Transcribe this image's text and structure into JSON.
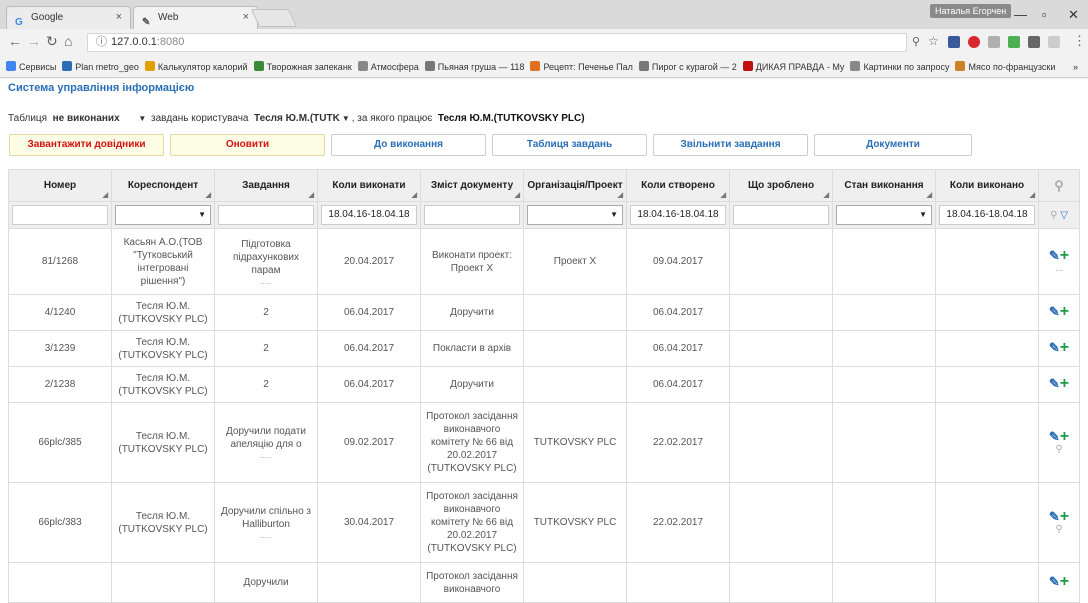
{
  "browser": {
    "tabs": [
      {
        "label": "Google",
        "icon": "G"
      },
      {
        "label": "Web",
        "icon": "✎"
      }
    ],
    "user_chip": "Наталья Егорчен",
    "url_host": "127.0.0.1",
    "url_port": ":8080",
    "bookmarks": [
      {
        "label": "Сервисы",
        "color": "#4285f4"
      },
      {
        "label": "Plan metro_geo",
        "color": "#2a6fb5"
      },
      {
        "label": "Калькулятор калорий",
        "color": "#e0a000"
      },
      {
        "label": "Творожная запеканк",
        "color": "#3a8a3a"
      },
      {
        "label": "Атмосфера",
        "color": "#888888"
      },
      {
        "label": "Пьяная груша — 118",
        "color": "#777777"
      },
      {
        "label": "Рецепт: Печенье Пал",
        "color": "#e07020"
      },
      {
        "label": "Пирог с курагой — 2",
        "color": "#777777"
      },
      {
        "label": "ДИКАЯ ПРАВДА - Му",
        "color": "#c01010"
      },
      {
        "label": "Картинки по запросу",
        "color": "#888888"
      },
      {
        "label": "Мясо по-французски",
        "color": "#d08020"
      }
    ]
  },
  "app": {
    "title": "Система управління інформацією",
    "filter": {
      "prefix": "Таблиця",
      "status": "не виконаних",
      "mid": "завдань користувача",
      "user": "Тесля Ю.М.(TUTK",
      "suffix": ", за якого працює",
      "works_for": "Тесля Ю.М.(TUTKOVSKY PLC)"
    },
    "buttons": [
      "Завантажити довідники",
      "Оновити",
      "До виконання",
      "Таблиця завдань",
      "Звільнити завдання",
      "Документи"
    ]
  },
  "table": {
    "columns": [
      "Номер",
      "Кореспондент",
      "Завдання",
      "Коли виконати",
      "Зміст документу",
      "Організація/Проект",
      "Коли створено",
      "Що зроблено",
      "Стан виконання",
      "Коли виконано",
      ""
    ],
    "filters": {
      "due": "18.04.16-18.04.18",
      "created": "18.04.16-18.04.18",
      "done": "18.04.16-18.04.18"
    },
    "rows": [
      {
        "num": "81/1268",
        "corr": "Касьян А.О.(ТОВ \"Тутковський інтегровані рішення\")",
        "task": "Підготовка підрахункових парам",
        "task_more": ".....",
        "due": "20.04.2017",
        "content": "Виконати проект: Проект X",
        "org": "Проект X",
        "created": "09.04.2017",
        "done_what": "",
        "state": "",
        "done_when": ""
      },
      {
        "num": "4/1240",
        "corr": "Тесля Ю.М. (TUTKOVSKY PLC)",
        "task": "2",
        "task_more": "",
        "due": "06.04.2017",
        "content": "Доручити",
        "org": "",
        "created": "06.04.2017",
        "done_what": "",
        "state": "",
        "done_when": ""
      },
      {
        "num": "3/1239",
        "corr": "Тесля Ю.М. (TUTKOVSKY PLC)",
        "task": "2",
        "task_more": "",
        "due": "06.04.2017",
        "content": "Покласти в архів",
        "org": "",
        "created": "06.04.2017",
        "done_what": "",
        "state": "",
        "done_when": ""
      },
      {
        "num": "2/1238",
        "corr": "Тесля Ю.М. (TUTKOVSKY PLC)",
        "task": "2",
        "task_more": "",
        "due": "06.04.2017",
        "content": "Доручити",
        "org": "",
        "created": "06.04.2017",
        "done_what": "",
        "state": "",
        "done_when": ""
      },
      {
        "num": "66plc/385",
        "corr": "Тесля Ю.М. (TUTKOVSKY PLC)",
        "task": "Доручили подати апеляцію для о",
        "task_more": ".....",
        "due": "09.02.2017",
        "content": "Протокол засідання виконавчого комітету № 66 від 20.02.2017 (TUTKOVSKY PLC)",
        "org": "TUTKOVSKY PLC",
        "created": "22.02.2017",
        "done_what": "",
        "state": "",
        "done_when": ""
      },
      {
        "num": "66plc/383",
        "corr": "Тесля Ю.М. (TUTKOVSKY PLC)",
        "task": "Доручили спільно з Halliburton",
        "task_more": ".....",
        "due": "30.04.2017",
        "content": "Протокол засідання виконавчого комітету № 66 від 20.02.2017 (TUTKOVSKY PLC)",
        "org": "TUTKOVSKY PLC",
        "created": "22.02.2017",
        "done_what": "",
        "state": "",
        "done_when": ""
      },
      {
        "num": "",
        "corr": "",
        "task": "Доручили",
        "task_more": "",
        "due": "",
        "content": "Протокол засідання виконавчого",
        "org": "",
        "created": "",
        "done_what": "",
        "state": "",
        "done_when": ""
      }
    ]
  },
  "colors": {
    "title_blue": "#2a6fb5",
    "warn_red": "#d31212",
    "add_green": "#1a9a4a"
  }
}
